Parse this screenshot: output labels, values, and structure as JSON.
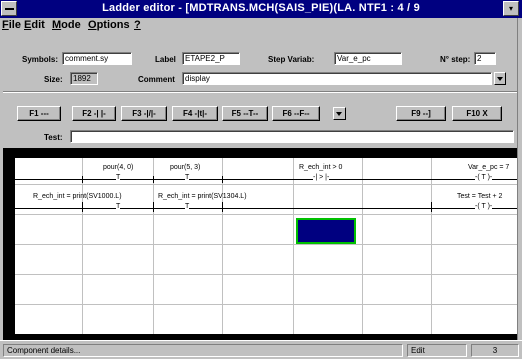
{
  "window": {
    "title": "Ladder editor - [MDTRANS.MCH(SAIS_PIE)(LA. NTF1 : 4 / 9",
    "min_glyph": "▾"
  },
  "menu": [
    {
      "key": "F",
      "rest": "ile"
    },
    {
      "key": "E",
      "rest": "dit"
    },
    {
      "key": "M",
      "rest": "ode"
    },
    {
      "key": "O",
      "rest": "ptions"
    },
    {
      "key": "?",
      "rest": ""
    }
  ],
  "fields": {
    "symbols_label": "Symbols:",
    "symbols_value": "comment.sy",
    "label_label": "Label",
    "label_value": "ETAPE2_P",
    "stepvar_label": "Step Variab:",
    "stepvar_value": "Var_e_pc",
    "nstep_label": "N° step:",
    "nstep_value": "2",
    "size_label": "Size:",
    "size_value": "1892",
    "comment_label": "Comment",
    "comment_value": "display",
    "test_label": "Test:",
    "test_value": ""
  },
  "toolbar": {
    "f1": "F1  ---",
    "f2": "F2  -| |-",
    "f3": "F3  -|/|-",
    "f4": "F4  -|t|-",
    "f5": "F5  --T--",
    "f6": "F6  --F--",
    "f9": "F9  --]",
    "f10": "F10  X"
  },
  "ladder": {
    "row1": [
      {
        "label": "pour(4, 0)",
        "symbol": "T"
      },
      {
        "label": "pour(5, 3)",
        "symbol": "T"
      },
      {
        "label": "R_ech_int > 0",
        "symbol": "-| > |-"
      },
      {
        "label": "Var_e_pc = 7",
        "symbol": "-( T )-"
      }
    ],
    "row2": [
      {
        "label": "R_ech_int = print(SV1000.L)",
        "symbol": "T"
      },
      {
        "label": "R_ech_int = print(SV1304.L)",
        "symbol": "T"
      },
      {
        "label": "Test = Test + 2",
        "symbol": "-( T )-"
      }
    ]
  },
  "status": {
    "message": "Component details...",
    "mode": "Edit",
    "extra": "3"
  },
  "colors": {
    "titlebar": "#000080",
    "cursor_fill": "#000080",
    "cursor_border": "#00c000"
  }
}
